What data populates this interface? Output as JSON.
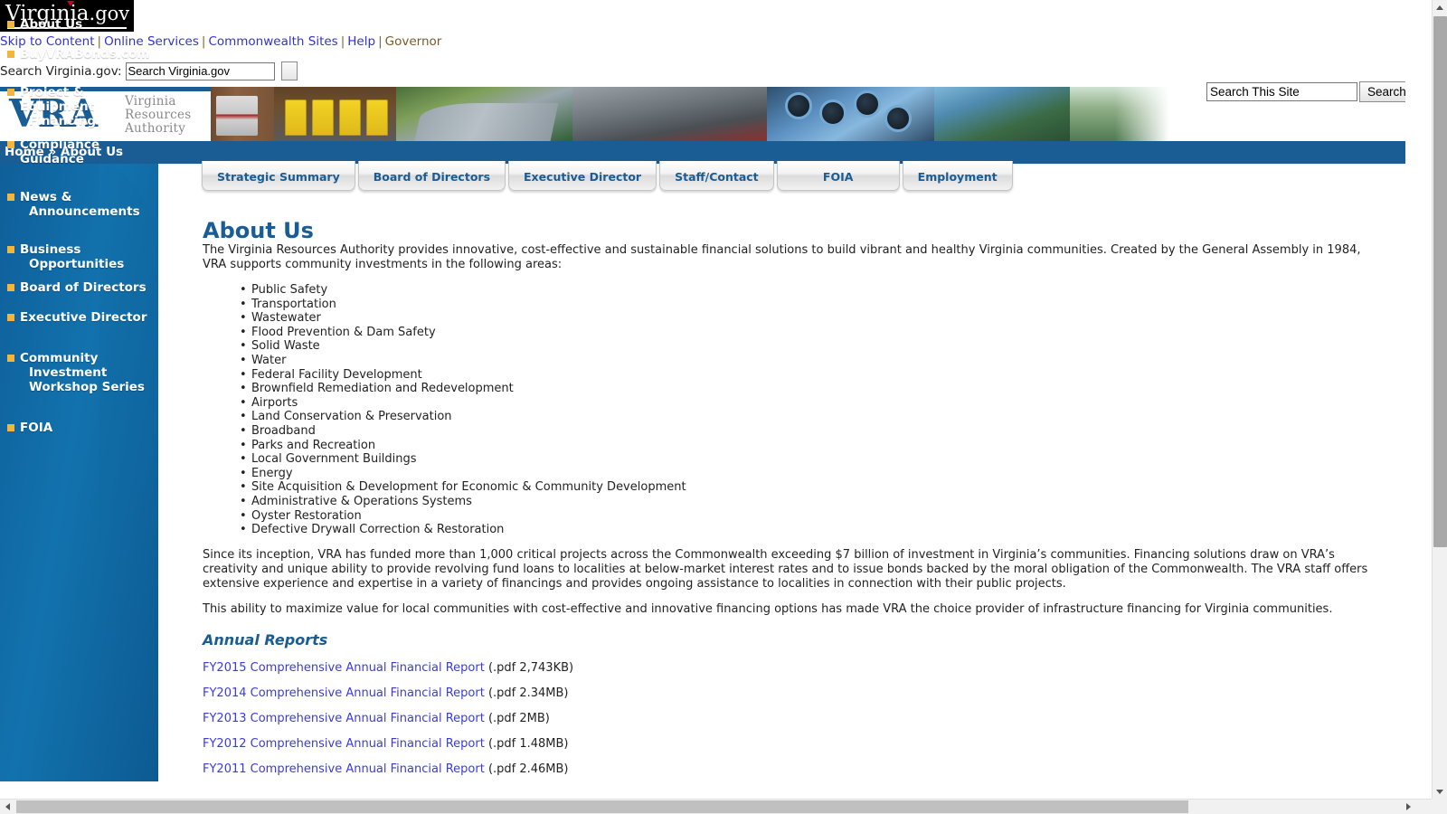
{
  "commonwealth_bar": {
    "logo_text": "Virginia",
    "logo_suffix": ".gov",
    "links": [
      {
        "label": "Skip to Content",
        "style": "blue"
      },
      {
        "label": "Online Services",
        "style": "blue"
      },
      {
        "label": "Commonwealth Sites",
        "style": "blue"
      },
      {
        "label": "Help",
        "style": "blue"
      },
      {
        "label": "Governor",
        "style": "gold"
      }
    ],
    "separator": "|",
    "search_label": "Search Virginia.gov:",
    "search_value": "Search Virginia.gov",
    "search_placeholder": "Search Virginia.gov"
  },
  "banner": {
    "acronym": "VRA",
    "name_line1": "Virginia",
    "name_line2": "Resources",
    "name_line3": "Authority",
    "site_search_value": "Search This Site",
    "site_search_placeholder": "Search This Site",
    "site_search_button": "Search"
  },
  "breadcrumb": {
    "home": "Home",
    "arrow": "»",
    "current": "About Us"
  },
  "sidebar": {
    "items": [
      {
        "label": "About Us",
        "lines": [
          "About Us"
        ]
      },
      {
        "label": "BuyVRABonds.com",
        "lines": [
          "BuyVRABonds.com"
        ]
      },
      {
        "label": "Project & Equipment Financing",
        "lines": [
          "Project & Equipment",
          "Financing"
        ]
      },
      {
        "label": "Compliance Guidance",
        "lines": [
          "Compliance Guidance"
        ]
      },
      {
        "label": "News & Announcements",
        "lines": [
          "News &",
          "Announcements"
        ]
      },
      {
        "label": "Business Opportunities",
        "lines": [
          "Business",
          "Opportunities"
        ]
      },
      {
        "label": "Board of Directors",
        "lines": [
          "Board of Directors"
        ]
      },
      {
        "label": "Executive Director",
        "lines": [
          "Executive Director"
        ]
      },
      {
        "label": "Community Investment Workshop Series",
        "lines": [
          "Community",
          "Investment",
          "Workshop Series"
        ]
      },
      {
        "label": "FOIA",
        "lines": [
          "FOIA"
        ]
      }
    ]
  },
  "tabs": [
    {
      "label": "Strategic Summary"
    },
    {
      "label": "Board of Directors"
    },
    {
      "label": "Executive Director"
    },
    {
      "label": "Staff/Contact"
    },
    {
      "label": "FOIA"
    },
    {
      "label": "Employment"
    }
  ],
  "main": {
    "title": "About Us",
    "intro": "The Virginia Resources Authority provides innovative, cost-effective and sustainable financial solutions to build vibrant and healthy Virginia communities. Created by the General Assembly in 1984, VRA supports community investments in the following areas:",
    "areas": [
      "Public Safety",
      "Transportation",
      "Wastewater",
      "Flood Prevention & Dam Safety",
      "Solid Waste",
      "Water",
      "Federal Facility Development",
      "Brownfield Remediation and Redevelopment",
      "Airports",
      "Land Conservation & Preservation",
      "Broadband",
      "Parks and Recreation",
      "Local Government Buildings",
      "Energy",
      "Site Acquisition & Development for Economic & Community Development",
      "Administrative & Operations Systems",
      "Oyster Restoration",
      "Defective Drywall Correction & Restoration"
    ],
    "paragraph2": "Since its inception, VRA has funded more than 1,000 critical projects across the Commonwealth exceeding $7 billion of investment in Virginia’s communities.  Financing solutions draw on VRA’s creativity and unique ability to provide revolving fund loans to localities at below-market interest rates and to issue bonds backed by the moral obligation of the Commonwealth.  The VRA staff offers extensive experience and expertise in a variety of financings and provides ongoing assistance to localities in connection with their public projects.",
    "paragraph3": "This ability to maximize value for local communities with cost-effective and innovative financing options has made VRA the choice provider of infrastructure financing for Virginia communities.",
    "annual_reports_heading": "Annual Reports",
    "annual_reports": [
      {
        "link": "FY2015 Comprehensive Annual Financial Report",
        "meta": "(.pdf 2,743KB)"
      },
      {
        "link": "FY2014 Comprehensive Annual Financial Report",
        "meta": "(.pdf 2.34MB)"
      },
      {
        "link": "FY2013 Comprehensive Annual Financial Report",
        "meta": "(.pdf 2MB)"
      },
      {
        "link": "FY2012 Comprehensive Annual Financial Report",
        "meta": "(.pdf 1.48MB)"
      },
      {
        "link": "FY2011 Comprehensive Annual Financial Report",
        "meta": "(.pdf 2.46MB)"
      }
    ]
  },
  "colors": {
    "brand_blue": "#1a5c94",
    "sidebar_blue": "#1272ad",
    "accent_gold": "#f2b63c",
    "link_blue": "#3b3bdd"
  }
}
